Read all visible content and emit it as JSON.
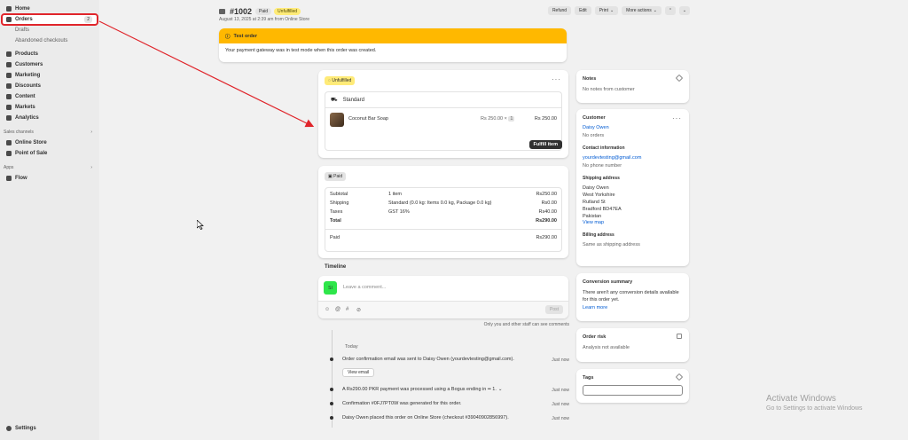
{
  "sidebar": {
    "items": [
      {
        "label": "Home",
        "icon": "home-icon"
      },
      {
        "label": "Orders",
        "icon": "inbox-icon",
        "badge": "2"
      },
      {
        "label": "Drafts",
        "sub": true
      },
      {
        "label": "Abandoned checkouts",
        "sub": true
      },
      {
        "label": "Products",
        "icon": "tag-icon"
      },
      {
        "label": "Customers",
        "icon": "person-icon"
      },
      {
        "label": "Marketing",
        "icon": "target-icon"
      },
      {
        "label": "Discounts",
        "icon": "discount-icon"
      },
      {
        "label": "Content",
        "icon": "content-icon"
      },
      {
        "label": "Markets",
        "icon": "globe-icon"
      },
      {
        "label": "Analytics",
        "icon": "chart-icon"
      }
    ],
    "sales_channels_title": "Sales channels",
    "sales_channels": [
      {
        "label": "Online Store",
        "icon": "store-icon"
      },
      {
        "label": "Point of Sale",
        "icon": "pos-icon"
      }
    ],
    "apps_title": "Apps",
    "apps": [
      {
        "label": "Flow",
        "icon": "flow-icon"
      }
    ],
    "settings": "Settings"
  },
  "order": {
    "title": "#1002",
    "paid_badge": "Paid",
    "status_badge": "Unfulfilled",
    "subtitle": "August 13, 2025 at 2:39 am from Online Store",
    "actions": {
      "refund": "Refund",
      "edit": "Edit",
      "print": "Print",
      "more": "More actions"
    }
  },
  "banner": {
    "title": "Test order",
    "body": "Your payment gateway was in test mode when this order was created."
  },
  "fulfillment": {
    "badge": "Unfulfilled",
    "delivery": "Standard",
    "item": {
      "name": "Coconut Bar Soap",
      "price": "Rs 250.00",
      "times": "×",
      "qty": "1",
      "total": "Rs 250.00"
    },
    "button": "Fulfill item"
  },
  "payment": {
    "badge": "Paid",
    "rows": [
      {
        "label": "Subtotal",
        "desc": "1 item",
        "amount": "Rs250.00"
      },
      {
        "label": "Shipping",
        "desc": "Standard (0.0 kg: Items 0.0 kg, Package 0.0 kg)",
        "amount": "Rs0.00"
      },
      {
        "label": "Taxes",
        "desc": "GST 16%",
        "amount": "Rs40.00"
      },
      {
        "label": "Total",
        "desc": "",
        "amount": "Rs290.00"
      }
    ],
    "paid_label": "Paid",
    "paid_amount": "Rs290.00"
  },
  "timeline": {
    "title": "Timeline",
    "avatar": "SI",
    "placeholder": "Leave a comment...",
    "post": "Post",
    "note": "Only you and other staff can see comments",
    "day": "Today",
    "events": [
      {
        "text": "Order confirmation email was sent to Daisy Owen (yourdevtesting@gmail.com).",
        "time": "Just now",
        "button": "View email"
      },
      {
        "text": "A Rs290.00 PKR payment was processed using a Bogus ending in •• 1.",
        "time": "Just now"
      },
      {
        "text": "Confirmation #0FJ7PT0W was generated for this order.",
        "time": "Just now"
      },
      {
        "text": "Daisy Owen placed this order on Online Store (checkout #39040902856997).",
        "time": "Just now"
      }
    ]
  },
  "notes": {
    "title": "Notes",
    "body": "No notes from customer"
  },
  "customer": {
    "title": "Customer",
    "name": "Daisy Owen",
    "orders": "No orders",
    "contact_title": "Contact information",
    "email": "yourdevtesting@gmail.com",
    "phone": "No phone number",
    "shipping_title": "Shipping address",
    "address": [
      "Daisy Owen",
      "West Yorkshire",
      "Rutland St",
      "Bradford BD47EA",
      "Pakistan"
    ],
    "view_map": "View map",
    "billing_title": "Billing address",
    "billing": "Same as shipping address"
  },
  "conversion": {
    "title": "Conversion summary",
    "body": "There aren't any conversion details available for this order yet.",
    "link": "Learn more"
  },
  "risk": {
    "title": "Order risk",
    "body": "Analysis not available"
  },
  "tags": {
    "title": "Tags"
  },
  "watermark": {
    "line1": "Activate Windows",
    "line2": "Go to Settings to activate Windows"
  },
  "colors": {
    "accent": "#ffb800",
    "annotation": "#e0252b",
    "link": "#005bd3"
  }
}
